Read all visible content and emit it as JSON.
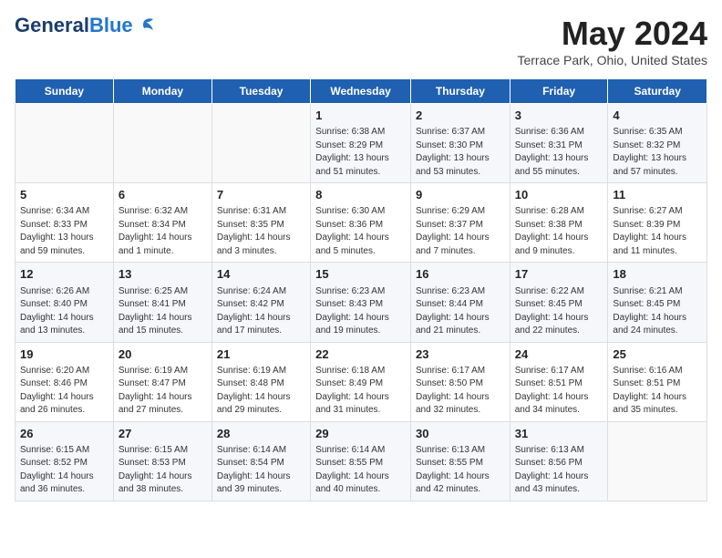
{
  "header": {
    "logo_line1": "General",
    "logo_line2": "Blue",
    "month": "May 2024",
    "location": "Terrace Park, Ohio, United States"
  },
  "weekdays": [
    "Sunday",
    "Monday",
    "Tuesday",
    "Wednesday",
    "Thursday",
    "Friday",
    "Saturday"
  ],
  "weeks": [
    [
      {
        "day": "",
        "sunrise": "",
        "sunset": "",
        "daylight": ""
      },
      {
        "day": "",
        "sunrise": "",
        "sunset": "",
        "daylight": ""
      },
      {
        "day": "",
        "sunrise": "",
        "sunset": "",
        "daylight": ""
      },
      {
        "day": "1",
        "sunrise": "Sunrise: 6:38 AM",
        "sunset": "Sunset: 8:29 PM",
        "daylight": "Daylight: 13 hours and 51 minutes."
      },
      {
        "day": "2",
        "sunrise": "Sunrise: 6:37 AM",
        "sunset": "Sunset: 8:30 PM",
        "daylight": "Daylight: 13 hours and 53 minutes."
      },
      {
        "day": "3",
        "sunrise": "Sunrise: 6:36 AM",
        "sunset": "Sunset: 8:31 PM",
        "daylight": "Daylight: 13 hours and 55 minutes."
      },
      {
        "day": "4",
        "sunrise": "Sunrise: 6:35 AM",
        "sunset": "Sunset: 8:32 PM",
        "daylight": "Daylight: 13 hours and 57 minutes."
      }
    ],
    [
      {
        "day": "5",
        "sunrise": "Sunrise: 6:34 AM",
        "sunset": "Sunset: 8:33 PM",
        "daylight": "Daylight: 13 hours and 59 minutes."
      },
      {
        "day": "6",
        "sunrise": "Sunrise: 6:32 AM",
        "sunset": "Sunset: 8:34 PM",
        "daylight": "Daylight: 14 hours and 1 minute."
      },
      {
        "day": "7",
        "sunrise": "Sunrise: 6:31 AM",
        "sunset": "Sunset: 8:35 PM",
        "daylight": "Daylight: 14 hours and 3 minutes."
      },
      {
        "day": "8",
        "sunrise": "Sunrise: 6:30 AM",
        "sunset": "Sunset: 8:36 PM",
        "daylight": "Daylight: 14 hours and 5 minutes."
      },
      {
        "day": "9",
        "sunrise": "Sunrise: 6:29 AM",
        "sunset": "Sunset: 8:37 PM",
        "daylight": "Daylight: 14 hours and 7 minutes."
      },
      {
        "day": "10",
        "sunrise": "Sunrise: 6:28 AM",
        "sunset": "Sunset: 8:38 PM",
        "daylight": "Daylight: 14 hours and 9 minutes."
      },
      {
        "day": "11",
        "sunrise": "Sunrise: 6:27 AM",
        "sunset": "Sunset: 8:39 PM",
        "daylight": "Daylight: 14 hours and 11 minutes."
      }
    ],
    [
      {
        "day": "12",
        "sunrise": "Sunrise: 6:26 AM",
        "sunset": "Sunset: 8:40 PM",
        "daylight": "Daylight: 14 hours and 13 minutes."
      },
      {
        "day": "13",
        "sunrise": "Sunrise: 6:25 AM",
        "sunset": "Sunset: 8:41 PM",
        "daylight": "Daylight: 14 hours and 15 minutes."
      },
      {
        "day": "14",
        "sunrise": "Sunrise: 6:24 AM",
        "sunset": "Sunset: 8:42 PM",
        "daylight": "Daylight: 14 hours and 17 minutes."
      },
      {
        "day": "15",
        "sunrise": "Sunrise: 6:23 AM",
        "sunset": "Sunset: 8:43 PM",
        "daylight": "Daylight: 14 hours and 19 minutes."
      },
      {
        "day": "16",
        "sunrise": "Sunrise: 6:23 AM",
        "sunset": "Sunset: 8:44 PM",
        "daylight": "Daylight: 14 hours and 21 minutes."
      },
      {
        "day": "17",
        "sunrise": "Sunrise: 6:22 AM",
        "sunset": "Sunset: 8:45 PM",
        "daylight": "Daylight: 14 hours and 22 minutes."
      },
      {
        "day": "18",
        "sunrise": "Sunrise: 6:21 AM",
        "sunset": "Sunset: 8:45 PM",
        "daylight": "Daylight: 14 hours and 24 minutes."
      }
    ],
    [
      {
        "day": "19",
        "sunrise": "Sunrise: 6:20 AM",
        "sunset": "Sunset: 8:46 PM",
        "daylight": "Daylight: 14 hours and 26 minutes."
      },
      {
        "day": "20",
        "sunrise": "Sunrise: 6:19 AM",
        "sunset": "Sunset: 8:47 PM",
        "daylight": "Daylight: 14 hours and 27 minutes."
      },
      {
        "day": "21",
        "sunrise": "Sunrise: 6:19 AM",
        "sunset": "Sunset: 8:48 PM",
        "daylight": "Daylight: 14 hours and 29 minutes."
      },
      {
        "day": "22",
        "sunrise": "Sunrise: 6:18 AM",
        "sunset": "Sunset: 8:49 PM",
        "daylight": "Daylight: 14 hours and 31 minutes."
      },
      {
        "day": "23",
        "sunrise": "Sunrise: 6:17 AM",
        "sunset": "Sunset: 8:50 PM",
        "daylight": "Daylight: 14 hours and 32 minutes."
      },
      {
        "day": "24",
        "sunrise": "Sunrise: 6:17 AM",
        "sunset": "Sunset: 8:51 PM",
        "daylight": "Daylight: 14 hours and 34 minutes."
      },
      {
        "day": "25",
        "sunrise": "Sunrise: 6:16 AM",
        "sunset": "Sunset: 8:51 PM",
        "daylight": "Daylight: 14 hours and 35 minutes."
      }
    ],
    [
      {
        "day": "26",
        "sunrise": "Sunrise: 6:15 AM",
        "sunset": "Sunset: 8:52 PM",
        "daylight": "Daylight: 14 hours and 36 minutes."
      },
      {
        "day": "27",
        "sunrise": "Sunrise: 6:15 AM",
        "sunset": "Sunset: 8:53 PM",
        "daylight": "Daylight: 14 hours and 38 minutes."
      },
      {
        "day": "28",
        "sunrise": "Sunrise: 6:14 AM",
        "sunset": "Sunset: 8:54 PM",
        "daylight": "Daylight: 14 hours and 39 minutes."
      },
      {
        "day": "29",
        "sunrise": "Sunrise: 6:14 AM",
        "sunset": "Sunset: 8:55 PM",
        "daylight": "Daylight: 14 hours and 40 minutes."
      },
      {
        "day": "30",
        "sunrise": "Sunrise: 6:13 AM",
        "sunset": "Sunset: 8:55 PM",
        "daylight": "Daylight: 14 hours and 42 minutes."
      },
      {
        "day": "31",
        "sunrise": "Sunrise: 6:13 AM",
        "sunset": "Sunset: 8:56 PM",
        "daylight": "Daylight: 14 hours and 43 minutes."
      },
      {
        "day": "",
        "sunrise": "",
        "sunset": "",
        "daylight": ""
      }
    ]
  ]
}
